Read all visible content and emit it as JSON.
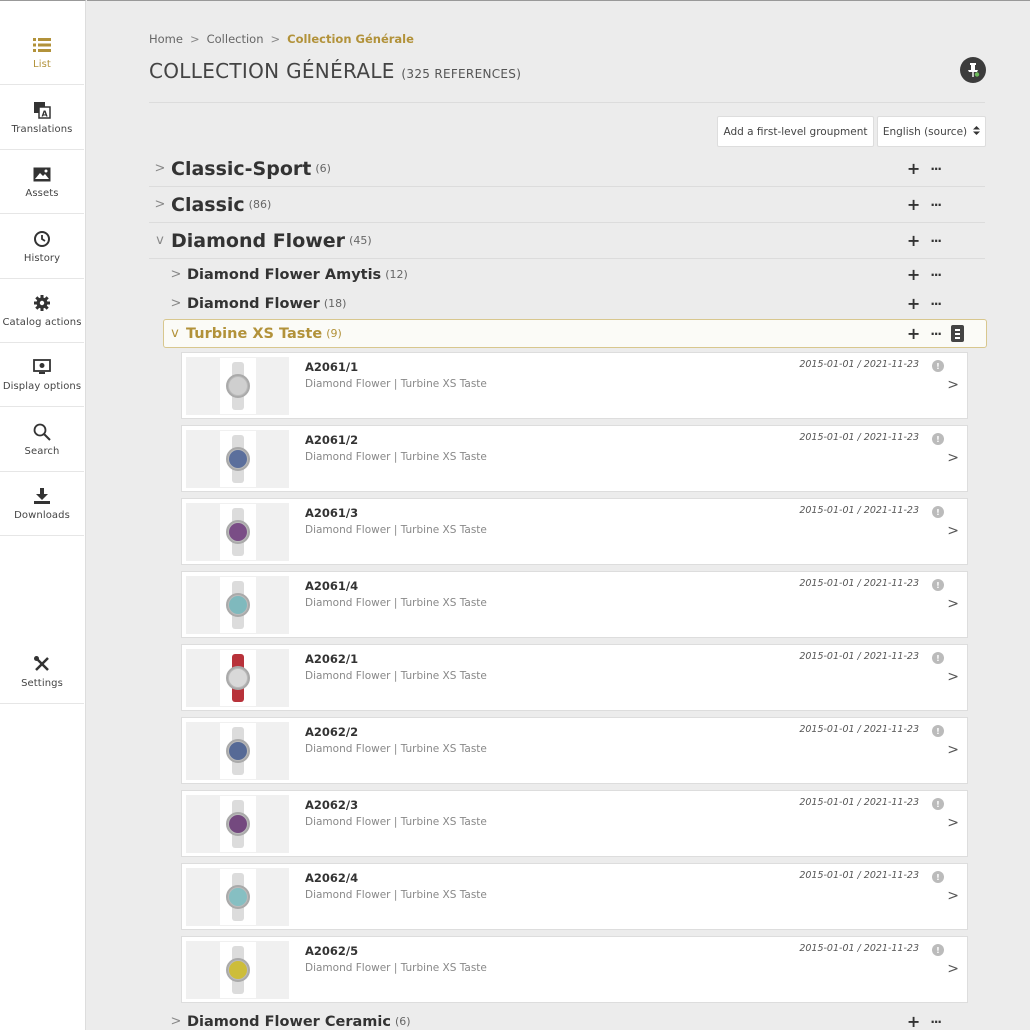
{
  "sidebar": {
    "items": [
      {
        "label": "List",
        "icon": "list-icon"
      },
      {
        "label": "Translations",
        "icon": "translate-icon"
      },
      {
        "label": "Assets",
        "icon": "image-icon"
      },
      {
        "label": "History",
        "icon": "history-icon"
      },
      {
        "label": "Catalog actions",
        "icon": "gear-icon"
      },
      {
        "label": "Display options",
        "icon": "display-settings-icon"
      },
      {
        "label": "Search",
        "icon": "search-icon"
      },
      {
        "label": "Downloads",
        "icon": "download-icon"
      }
    ],
    "settings": {
      "label": "Settings",
      "icon": "tools-icon"
    },
    "accent_color": "#b2923a"
  },
  "breadcrumb": {
    "home": "Home",
    "sep1": ">",
    "collection": "Collection",
    "sep2": ">",
    "current": "Collection Générale"
  },
  "header": {
    "title": "COLLECTION GÉNÉRALE",
    "count": "(325 REFERENCES)"
  },
  "toolbar": {
    "add_label": "Add a first-level groupment",
    "lang_label": "English (source)"
  },
  "groups": {
    "g1": {
      "name": "Classic-Sport",
      "count": "(6)"
    },
    "g2": {
      "name": "Classic",
      "count": "(86)"
    },
    "g3": {
      "name": "Diamond Flower",
      "count": "(45)"
    },
    "s1": {
      "name": "Diamond Flower Amytis",
      "count": "(12)"
    },
    "s2": {
      "name": "Diamond Flower",
      "count": "(18)"
    },
    "s3": {
      "name": "Turbine XS Taste",
      "count": "(9)"
    },
    "s4": {
      "name": "Diamond Flower Ceramic",
      "count": "(6)"
    }
  },
  "glyphs": {
    "chev_right": ">",
    "chev_down": "v",
    "plus": "+",
    "dots": "···",
    "arrow": ">",
    "info": "!"
  },
  "products": [
    {
      "ref": "A2061/1",
      "path": "Diamond Flower | Turbine XS Taste",
      "dates": "2015-01-01 / 2021-11-23",
      "dial": "#cfcfcf"
    },
    {
      "ref": "A2061/2",
      "path": "Diamond Flower | Turbine XS Taste",
      "dates": "2015-01-01 / 2021-11-23",
      "dial": "#5b6f9c"
    },
    {
      "ref": "A2061/3",
      "path": "Diamond Flower | Turbine XS Taste",
      "dates": "2015-01-01 / 2021-11-23",
      "dial": "#7a4d86"
    },
    {
      "ref": "A2061/4",
      "path": "Diamond Flower | Turbine XS Taste",
      "dates": "2015-01-01 / 2021-11-23",
      "dial": "#7fb9bd"
    },
    {
      "ref": "A2062/1",
      "path": "Diamond Flower | Turbine XS Taste",
      "dates": "2015-01-01 / 2021-11-23",
      "dial": "#d9d9d9"
    },
    {
      "ref": "A2062/2",
      "path": "Diamond Flower | Turbine XS Taste",
      "dates": "2015-01-01 / 2021-11-23",
      "dial": "#566a96"
    },
    {
      "ref": "A2062/3",
      "path": "Diamond Flower | Turbine XS Taste",
      "dates": "2015-01-01 / 2021-11-23",
      "dial": "#74497f"
    },
    {
      "ref": "A2062/4",
      "path": "Diamond Flower | Turbine XS Taste",
      "dates": "2015-01-01 / 2021-11-23",
      "dial": "#86bfc2"
    },
    {
      "ref": "A2062/5",
      "path": "Diamond Flower | Turbine XS Taste",
      "dates": "2015-01-01 / 2021-11-23",
      "dial": "#cdbd3a"
    }
  ]
}
